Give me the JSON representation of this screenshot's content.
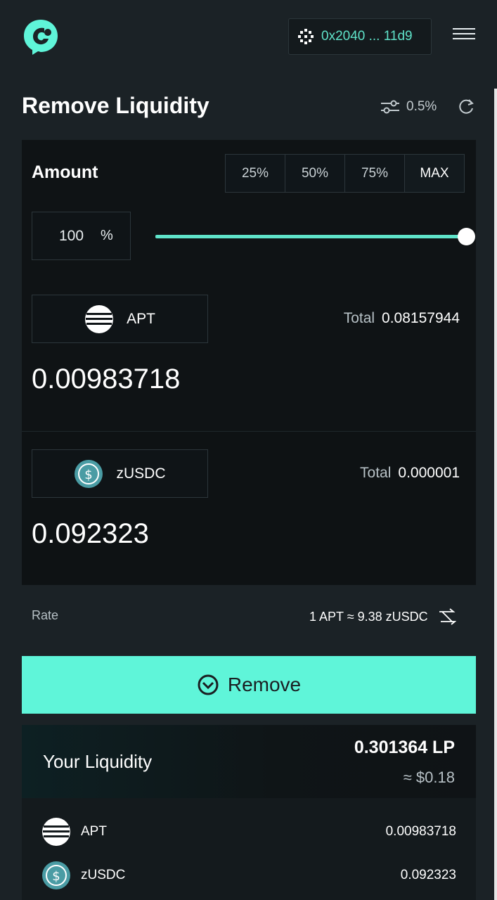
{
  "header": {
    "wallet_address": "0x2040 ... 11d9"
  },
  "title": "Remove Liquidity",
  "slippage": "0.5%",
  "amount": {
    "label": "Amount",
    "percent_buttons": [
      "25%",
      "50%",
      "75%",
      "MAX"
    ],
    "input_value": "100",
    "input_unit": "%",
    "slider_percent": 100
  },
  "tokens": [
    {
      "symbol": "APT",
      "total_label": "Total",
      "total_value": "0.08157944",
      "amount": "0.00983718"
    },
    {
      "symbol": "zUSDC",
      "total_label": "Total",
      "total_value": "0.000001",
      "amount": "0.092323"
    }
  ],
  "rate": {
    "label": "Rate",
    "value": "1 APT ≈ 9.38 zUSDC"
  },
  "remove_button": "Remove",
  "your_liquidity": {
    "title": "Your Liquidity",
    "lp_amount": "0.301364 LP",
    "usd_value": "≈ $0.18",
    "rows": [
      {
        "symbol": "APT",
        "value": "0.00983718"
      },
      {
        "symbol": "zUSDC",
        "value": "0.092323"
      }
    ]
  },
  "colors": {
    "accent": "#5ff5d9",
    "accent_text": "#5fe3c9",
    "background": "#1b2226",
    "card": "#0e1214"
  },
  "icons": [
    "app-logo-icon",
    "wallet-icon",
    "menu-icon",
    "settings-sliders-icon",
    "refresh-icon",
    "apt-coin-icon",
    "usdc-coin-icon",
    "swap-direction-icon",
    "remove-circle-icon"
  ]
}
